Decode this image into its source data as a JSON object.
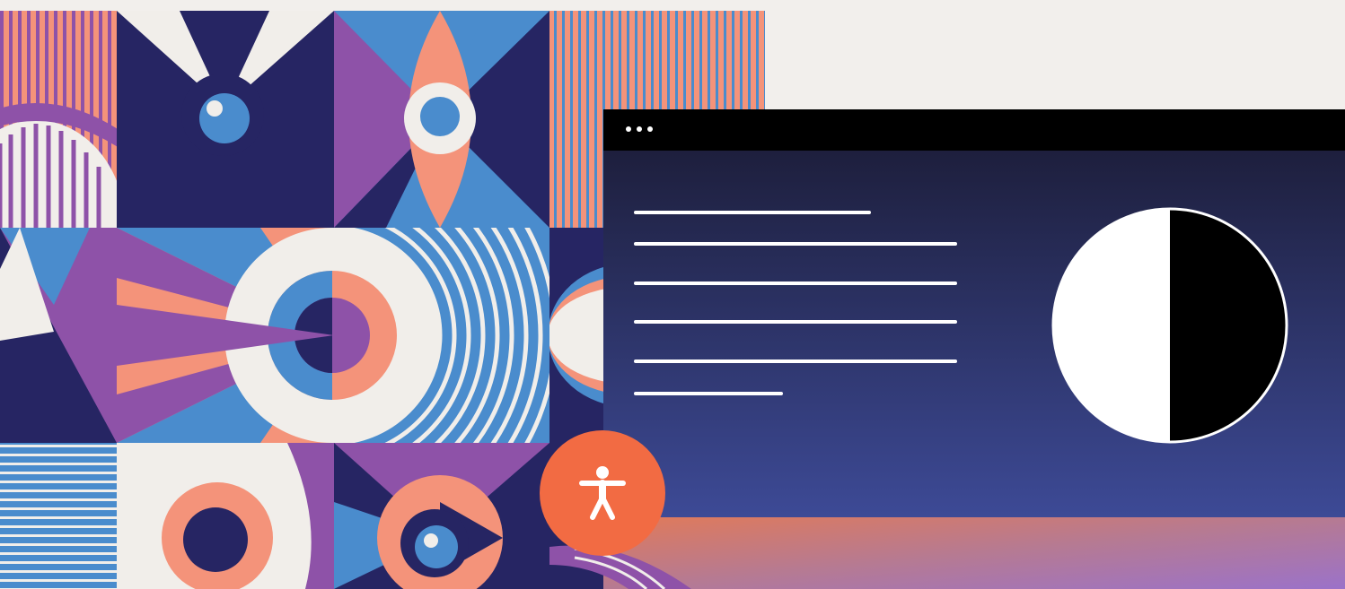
{
  "illustration": {
    "icons": [
      "eye-icon",
      "half-circle-contrast-icon",
      "accessibility-person-icon",
      "window-dots-icon"
    ]
  },
  "browser_window": {
    "dot_count": 3,
    "icon": "ellipsis-icon",
    "text_placeholder_lines": 6,
    "contrast_icon": "half-circle-contrast-icon"
  },
  "accessibility_button": {
    "icon": "accessibility-person-icon"
  },
  "colors": {
    "background": "#f2efec",
    "navy": "#262563",
    "blue": "#4a8ccd",
    "purple": "#8e52a8",
    "salmon": "#f4937a",
    "cream": "#f1eeea",
    "accent_orange": "#f26b43",
    "window_bar": "#000000",
    "window_gradient_top": "#1a1a33",
    "window_gradient_bottom": "#3d4a96"
  }
}
